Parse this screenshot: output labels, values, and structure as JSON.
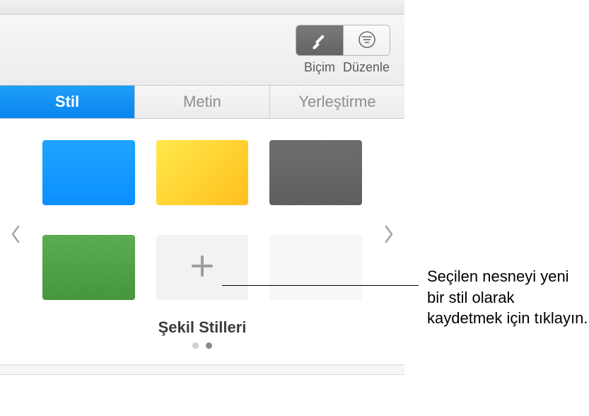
{
  "toolbar": {
    "format_label": "Biçim",
    "arrange_label": "Düzenle"
  },
  "tabs": {
    "style": "Stil",
    "text": "Metin",
    "arrange": "Yerleştirme"
  },
  "styles": {
    "title": "Şekil Stilleri",
    "items": [
      {
        "name": "blue-style",
        "color": "#0a8fff",
        "type": "solid"
      },
      {
        "name": "yellow-style",
        "color": "#ffc425",
        "type": "gradient"
      },
      {
        "name": "gray-style",
        "color": "#6c6c6c",
        "type": "texture"
      },
      {
        "name": "green-style",
        "color": "#53a44a",
        "type": "texture"
      },
      {
        "name": "add-style",
        "type": "add"
      },
      {
        "name": "empty-style",
        "type": "empty"
      }
    ],
    "pagination": {
      "total": 2,
      "current": 2
    }
  },
  "callout": {
    "text": "Seçilen nesneyi yeni bir stil olarak kaydetmek için tıklayın."
  }
}
